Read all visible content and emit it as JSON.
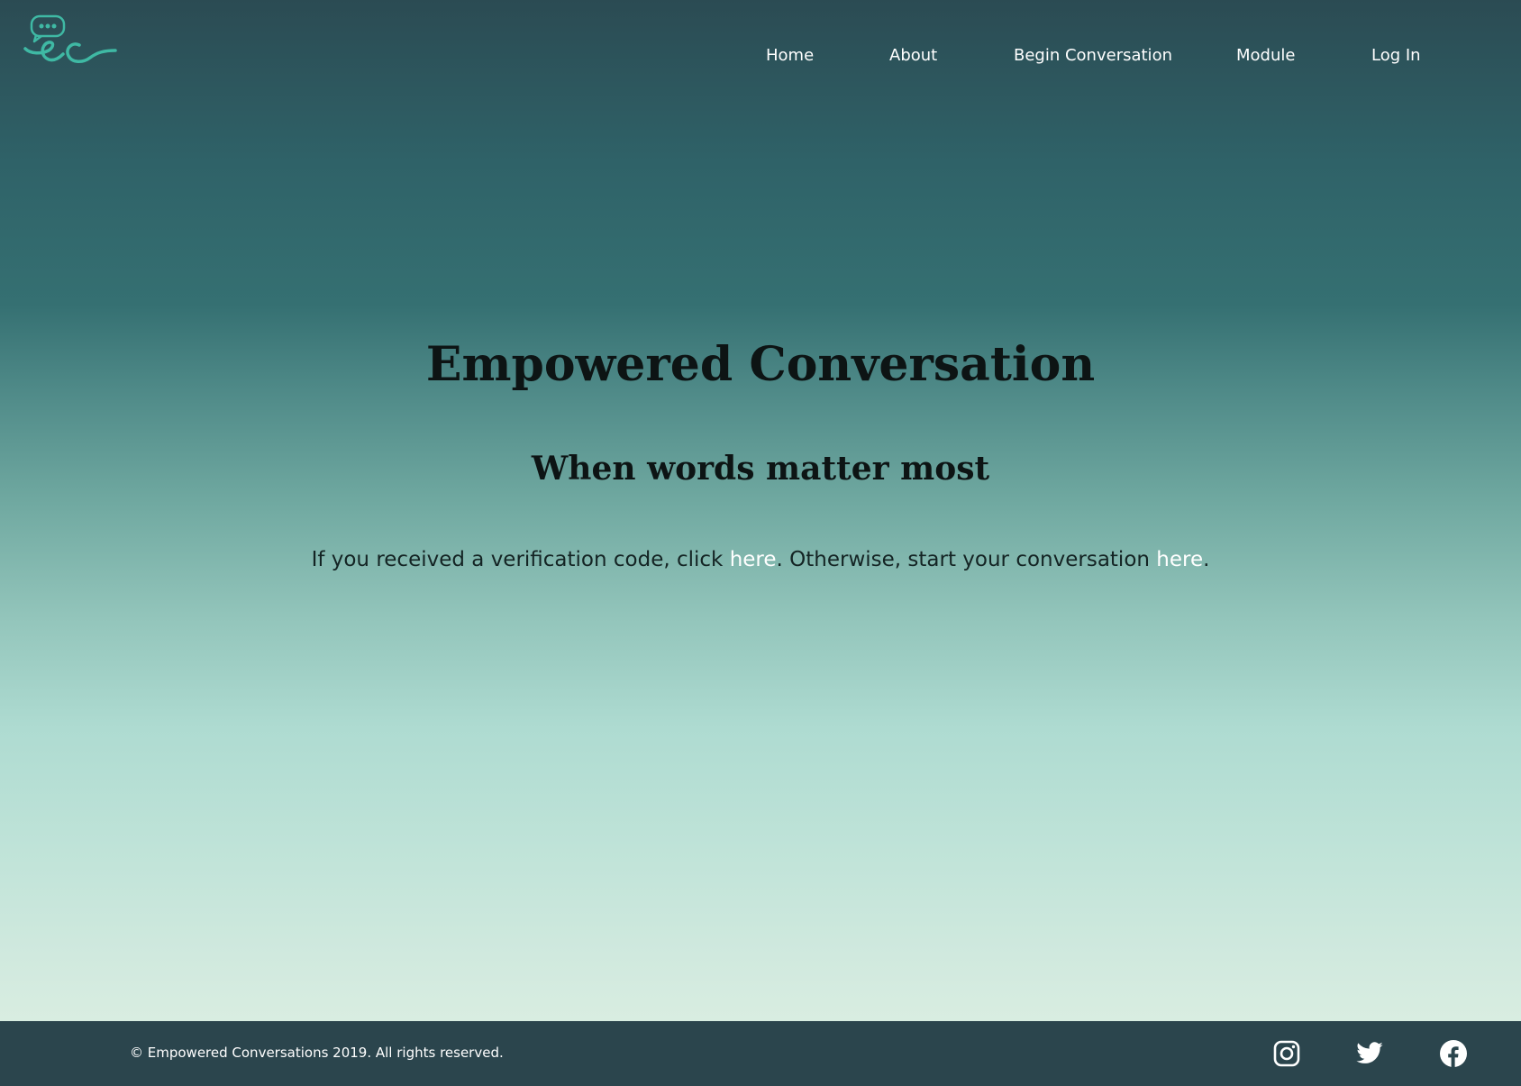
{
  "nav": {
    "items": [
      {
        "label": "Home"
      },
      {
        "label": "About"
      },
      {
        "label": "Begin Conversation"
      },
      {
        "label": "Module"
      },
      {
        "label": "Log In"
      }
    ],
    "logo_icon": "ec-chat-bubble-logo"
  },
  "hero": {
    "title": "Empowered Conversation",
    "subtitle": "When words matter most",
    "text_part1": "If you received a verification code, click ",
    "link1": "here",
    "text_part2": ". Otherwise, start your conversation ",
    "link2": "here",
    "text_part3": "."
  },
  "footer": {
    "copyright": "© Empowered Conversations 2019. All rights reserved.",
    "social_icons": [
      "instagram-icon",
      "twitter-icon",
      "facebook-icon"
    ]
  },
  "colors": {
    "footer_bg": "#2b454d",
    "accent_teal": "#3fb9a4",
    "link": "#ffffff",
    "heading": "#0d1414"
  }
}
